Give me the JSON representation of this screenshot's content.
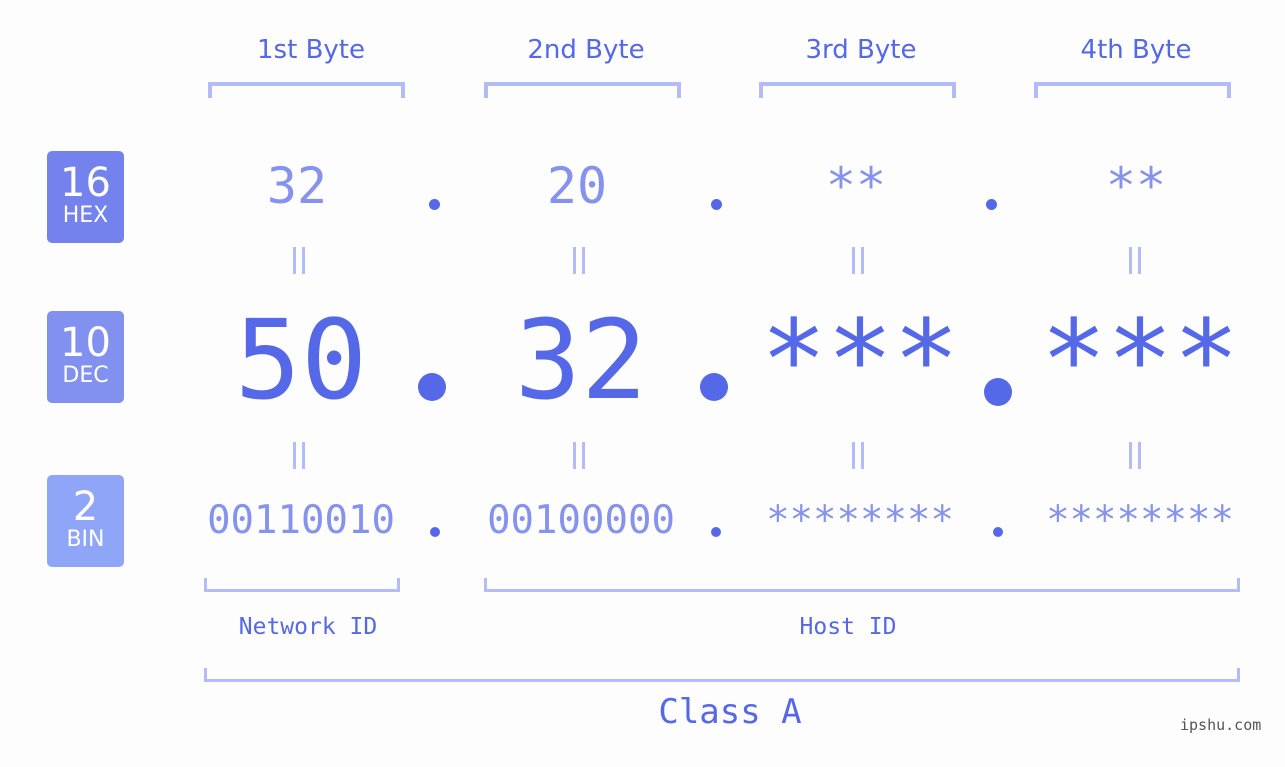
{
  "colors": {
    "hex_badge": "#7382ec",
    "dec_badge": "#8291f0",
    "bin_badge": "#8fa6f8",
    "primary": "#5468e8",
    "secondary": "#8592ee",
    "bracket": "#b3bcf6"
  },
  "badges": {
    "hex": {
      "number": "16",
      "label": "HEX"
    },
    "dec": {
      "number": "10",
      "label": "DEC"
    },
    "bin": {
      "number": "2",
      "label": "BIN"
    }
  },
  "byte_headers": [
    "1st Byte",
    "2nd Byte",
    "3rd Byte",
    "4th Byte"
  ],
  "hex_values": [
    "32",
    "20",
    "**",
    "**"
  ],
  "dec_values": [
    "50",
    "32",
    "***",
    "***"
  ],
  "bin_values": [
    "00110010",
    "00100000",
    "********",
    "********"
  ],
  "network_label": "Network ID",
  "host_label": "Host ID",
  "class_label": "Class A",
  "watermark": "ipshu.com"
}
